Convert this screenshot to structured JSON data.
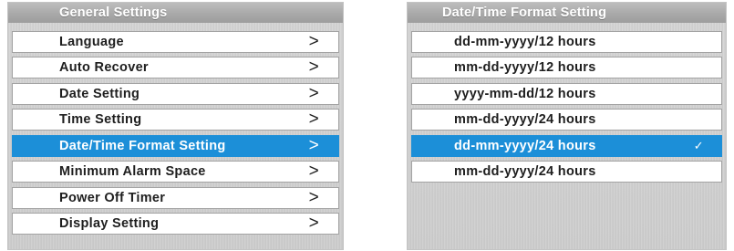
{
  "general_settings": {
    "title": "General Settings",
    "selected_index": 4,
    "items": [
      {
        "label": "Language",
        "arrow": ">"
      },
      {
        "label": "Auto Recover",
        "arrow": ">"
      },
      {
        "label": "Date Setting",
        "arrow": ">"
      },
      {
        "label": "Time Setting",
        "arrow": ">"
      },
      {
        "label": "Date/Time Format Setting",
        "arrow": ">"
      },
      {
        "label": "Minimum Alarm Space",
        "arrow": ">"
      },
      {
        "label": "Power Off Timer",
        "arrow": ">"
      },
      {
        "label": "Display Setting",
        "arrow": ">"
      }
    ]
  },
  "format_setting": {
    "title": "Date/Time Format Setting",
    "selected_index": 4,
    "check_mark": "✓",
    "options": [
      {
        "label": "dd-mm-yyyy/12 hours"
      },
      {
        "label": "mm-dd-yyyy/12 hours"
      },
      {
        "label": "yyyy-mm-dd/12 hours"
      },
      {
        "label": "mm-dd-yyyy/24 hours"
      },
      {
        "label": "dd-mm-yyyy/24 hours"
      },
      {
        "label": "mm-dd-yyyy/24 hours"
      }
    ]
  },
  "colors": {
    "selected_row": "#1c8fd8",
    "header_text": "#ffffff",
    "row_text": "#1e1e1e"
  },
  "icons": {
    "arrow": "chevron-right-icon",
    "check": "check-icon"
  }
}
